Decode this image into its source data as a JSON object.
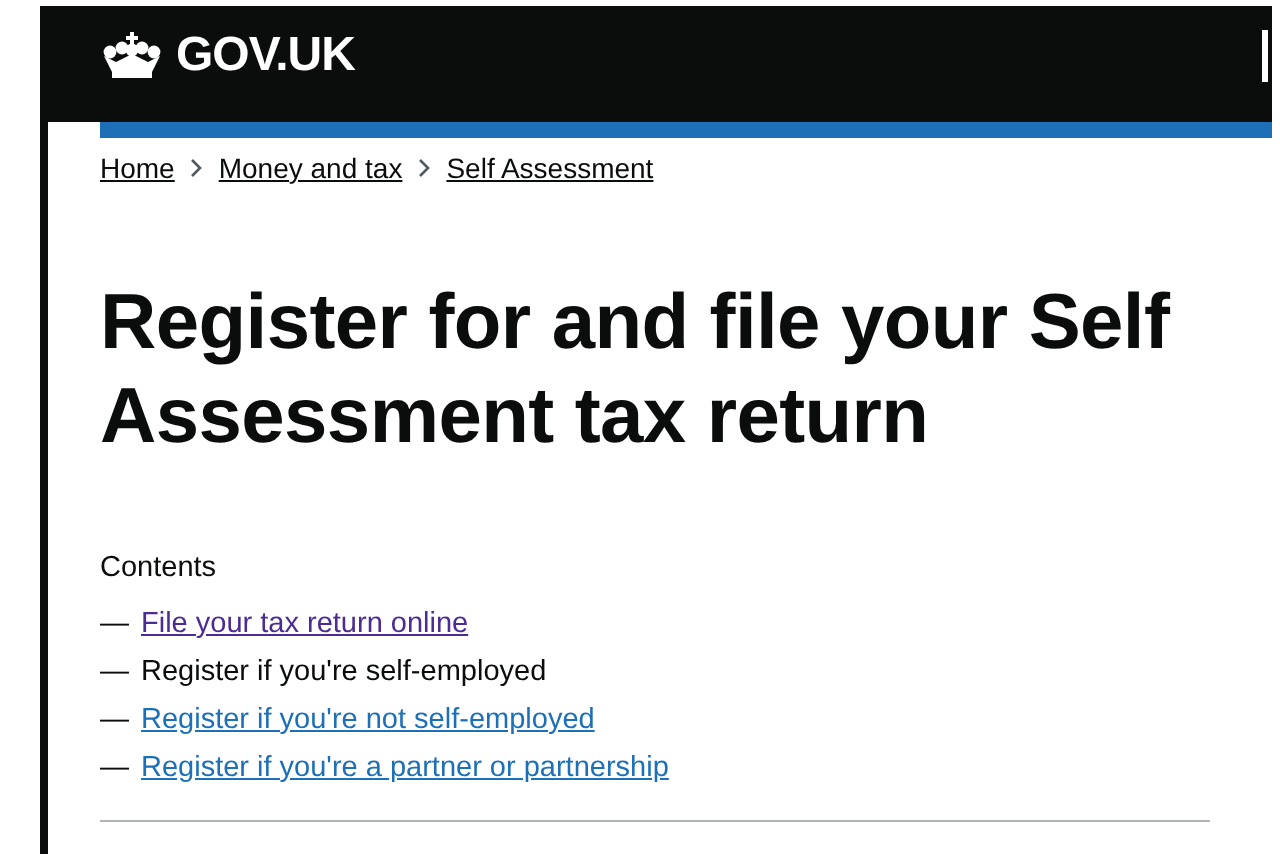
{
  "header": {
    "logo_text": "GOV.UK"
  },
  "breadcrumbs": [
    {
      "label": "Home"
    },
    {
      "label": "Money and tax"
    },
    {
      "label": "Self Assessment"
    }
  ],
  "title": "Register for and file your Self Assessment tax return",
  "contents": {
    "heading": "Contents",
    "items": [
      {
        "marker": "—",
        "label": "File your tax return online",
        "kind": "visited"
      },
      {
        "marker": "—",
        "label": "Register if you're self-employed",
        "kind": "current"
      },
      {
        "marker": "—",
        "label": "Register if you're not self-employed",
        "kind": "link"
      },
      {
        "marker": "—",
        "label": "Register if you're a partner or partnership",
        "kind": "link"
      }
    ]
  }
}
